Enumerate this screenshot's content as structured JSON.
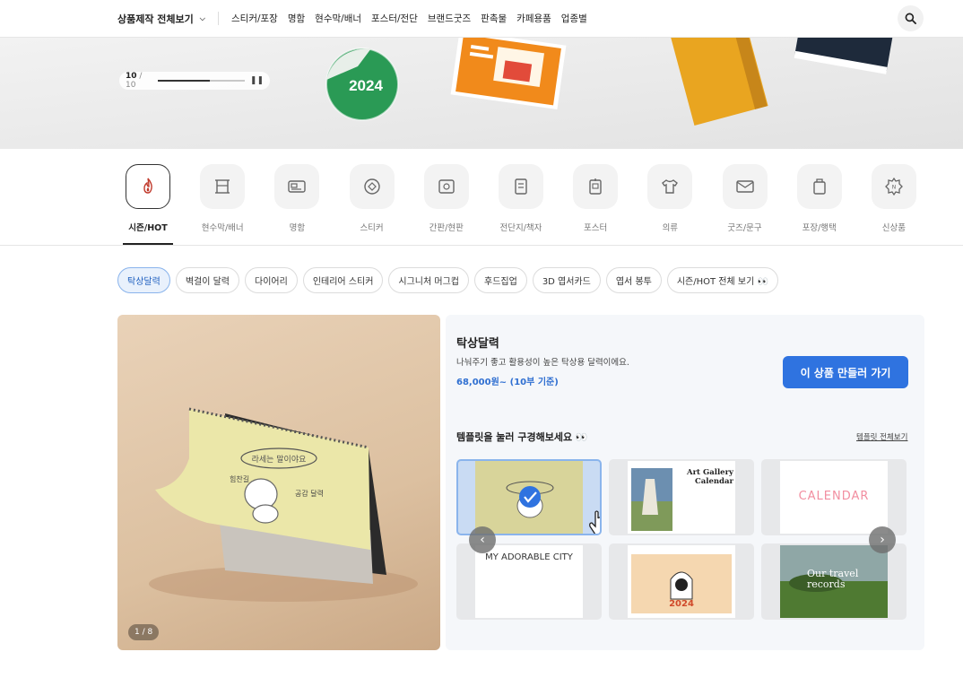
{
  "nav": {
    "all_menu": "상품제작 전체보기",
    "items": [
      "스티커/포장",
      "명함",
      "현수막/배너",
      "포스터/전단",
      "브랜드굿즈",
      "판촉물",
      "카페용품",
      "업종별"
    ]
  },
  "banner": {
    "current": "10",
    "total": "/ 10",
    "progress": 0.6,
    "sticker_text": "2024"
  },
  "categories": [
    {
      "label": "시즌/HOT",
      "icon": "flame-icon",
      "active": true
    },
    {
      "label": "현수막/배너",
      "icon": "banner-icon"
    },
    {
      "label": "명함",
      "icon": "business-card-icon"
    },
    {
      "label": "스티커",
      "icon": "sticker-icon"
    },
    {
      "label": "간판/현판",
      "icon": "signboard-icon"
    },
    {
      "label": "전단지/책자",
      "icon": "flyer-icon"
    },
    {
      "label": "포스터",
      "icon": "poster-icon"
    },
    {
      "label": "의류",
      "icon": "tshirt-icon"
    },
    {
      "label": "굿즈/문구",
      "icon": "envelope-icon"
    },
    {
      "label": "포장/행택",
      "icon": "package-icon"
    },
    {
      "label": "신상품",
      "icon": "new-badge-icon"
    }
  ],
  "chips": [
    "탁상달력",
    "벽걸이 달력",
    "다이어리",
    "인테리어 스티커",
    "시그니처 머그컵",
    "후드집업",
    "3D 엽서카드",
    "엽서 봉투",
    "시즌/HOT 전체 보기 👀"
  ],
  "product": {
    "title": "탁상달력",
    "description": "나눠주기 좋고 활용성이 높은 탁상용 달력이에요.",
    "price": "68,000원~ (10부 기준)",
    "cta": "이 상품 만들러 가기",
    "photo_page": "1 / 8"
  },
  "templates": {
    "heading": "템플릿을 눌러 구경해보세요 👀",
    "view_all": "템플릿 전체보기",
    "items": [
      {
        "title": "",
        "selected": true
      },
      {
        "title": "Art Gallery Calendar"
      },
      {
        "title": "CALENDAR"
      },
      {
        "title": "MY ADORABLE CITY"
      },
      {
        "title": "2024"
      },
      {
        "title": "Our travel records"
      }
    ]
  },
  "colors": {
    "accent": "#2f73e0",
    "price": "#2f6fd1",
    "chip_active_bg": "#e9f1fc"
  }
}
